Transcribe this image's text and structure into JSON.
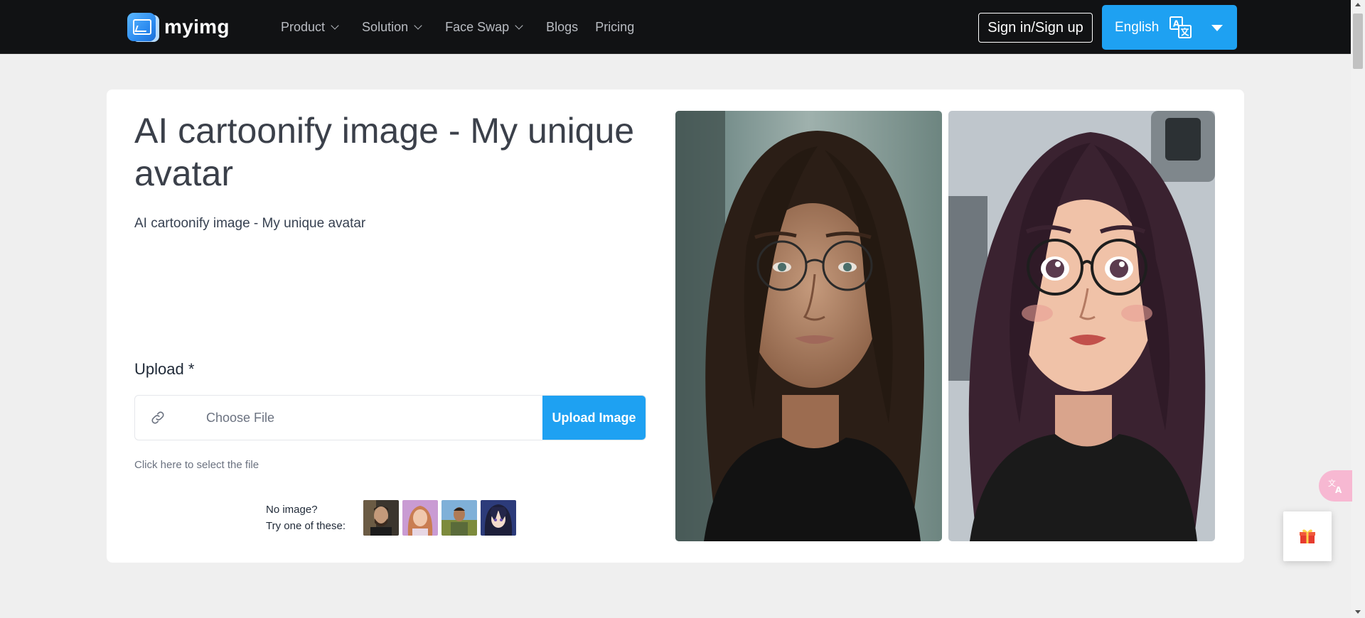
{
  "brand": {
    "name": "myimg"
  },
  "nav": {
    "items": [
      {
        "label": "Product",
        "has_dropdown": true
      },
      {
        "label": "Solution",
        "has_dropdown": true
      },
      {
        "label": "Face Swap",
        "has_dropdown": true
      },
      {
        "label": "Blogs",
        "has_dropdown": false
      },
      {
        "label": "Pricing",
        "has_dropdown": false
      }
    ],
    "signin_label": "Sign in/Sign up",
    "language_label": "English"
  },
  "main": {
    "title": "AI cartoonify image - My unique avatar",
    "subtitle": "AI cartoonify image - My unique avatar",
    "upload": {
      "label": "Upload *",
      "input_placeholder": "Choose File",
      "button_label": "Upload Image",
      "helper_text": "Click here to select the file"
    },
    "samples": {
      "line1": "No image?",
      "line2": "Try one of these:",
      "count": 4
    },
    "preview": {
      "before": "original-photo",
      "after": "cartoon-avatar"
    }
  },
  "colors": {
    "navbar_bg": "#111214",
    "accent": "#1ea1f2",
    "page_bg": "#efefef",
    "card_bg": "#ffffff",
    "translate_float": "#f7b8d2"
  },
  "icons": {
    "link": "link-icon",
    "translate": "translate-icon",
    "gift": "gift-icon",
    "caret": "caret-down-icon"
  }
}
